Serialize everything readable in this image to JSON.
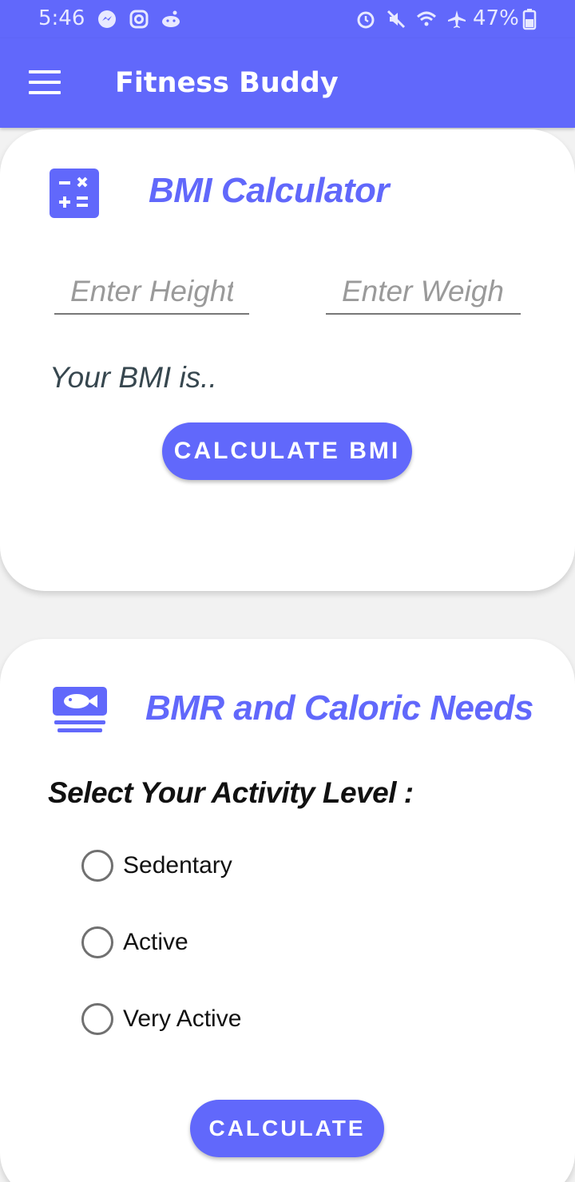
{
  "status_bar": {
    "time": "5:46",
    "battery": "47%",
    "left_icons": [
      "messenger-icon",
      "instagram-icon",
      "reddit-icon"
    ],
    "right_icons": [
      "alarm-icon",
      "mute-icon",
      "wifi-icon",
      "airplane-icon",
      "battery-icon"
    ]
  },
  "app_bar": {
    "title": "Fitness Buddy",
    "menu_icon": "hamburger-menu-icon"
  },
  "bmi_card": {
    "title": "BMI Calculator",
    "icon": "calculator-icon",
    "height_placeholder": "Enter Height",
    "weight_placeholder": "Enter Weight",
    "height_value": "",
    "weight_value": "",
    "result_text": "Your BMI is..",
    "button_label": "CALCULATE BMI"
  },
  "bmr_card": {
    "title": "BMR and Caloric Needs",
    "icon": "fish-plate-icon",
    "activity_heading": "Select Your Activity Level :",
    "options": [
      {
        "label": "Sedentary",
        "selected": false
      },
      {
        "label": "Active",
        "selected": false
      },
      {
        "label": "Very Active",
        "selected": false
      }
    ],
    "button_label": "CALCULATE"
  },
  "colors": {
    "primary": "#6168fb",
    "text_dark": "#37474f",
    "placeholder": "#9a9a9a"
  }
}
